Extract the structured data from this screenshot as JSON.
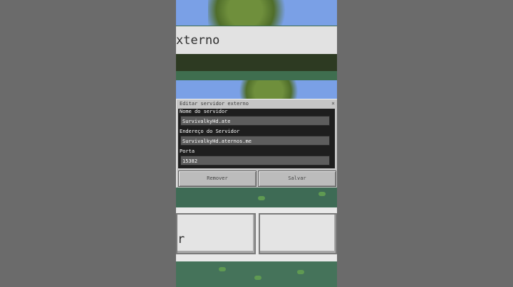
{
  "banner": {
    "text": "xterno"
  },
  "dialog": {
    "title": "Editar servidor externo",
    "close": "×",
    "fields": [
      {
        "label": "Nome do servidor",
        "value": "SurvivalkyHd.ate"
      },
      {
        "label": "Endereço do Servidor",
        "value": "SurvivalkyHd.aternos.me"
      },
      {
        "label": "Porta",
        "value": "15382"
      }
    ],
    "remove_button": "Remover",
    "save_button": "Salvar"
  },
  "lower": {
    "left_button_label": "r"
  }
}
